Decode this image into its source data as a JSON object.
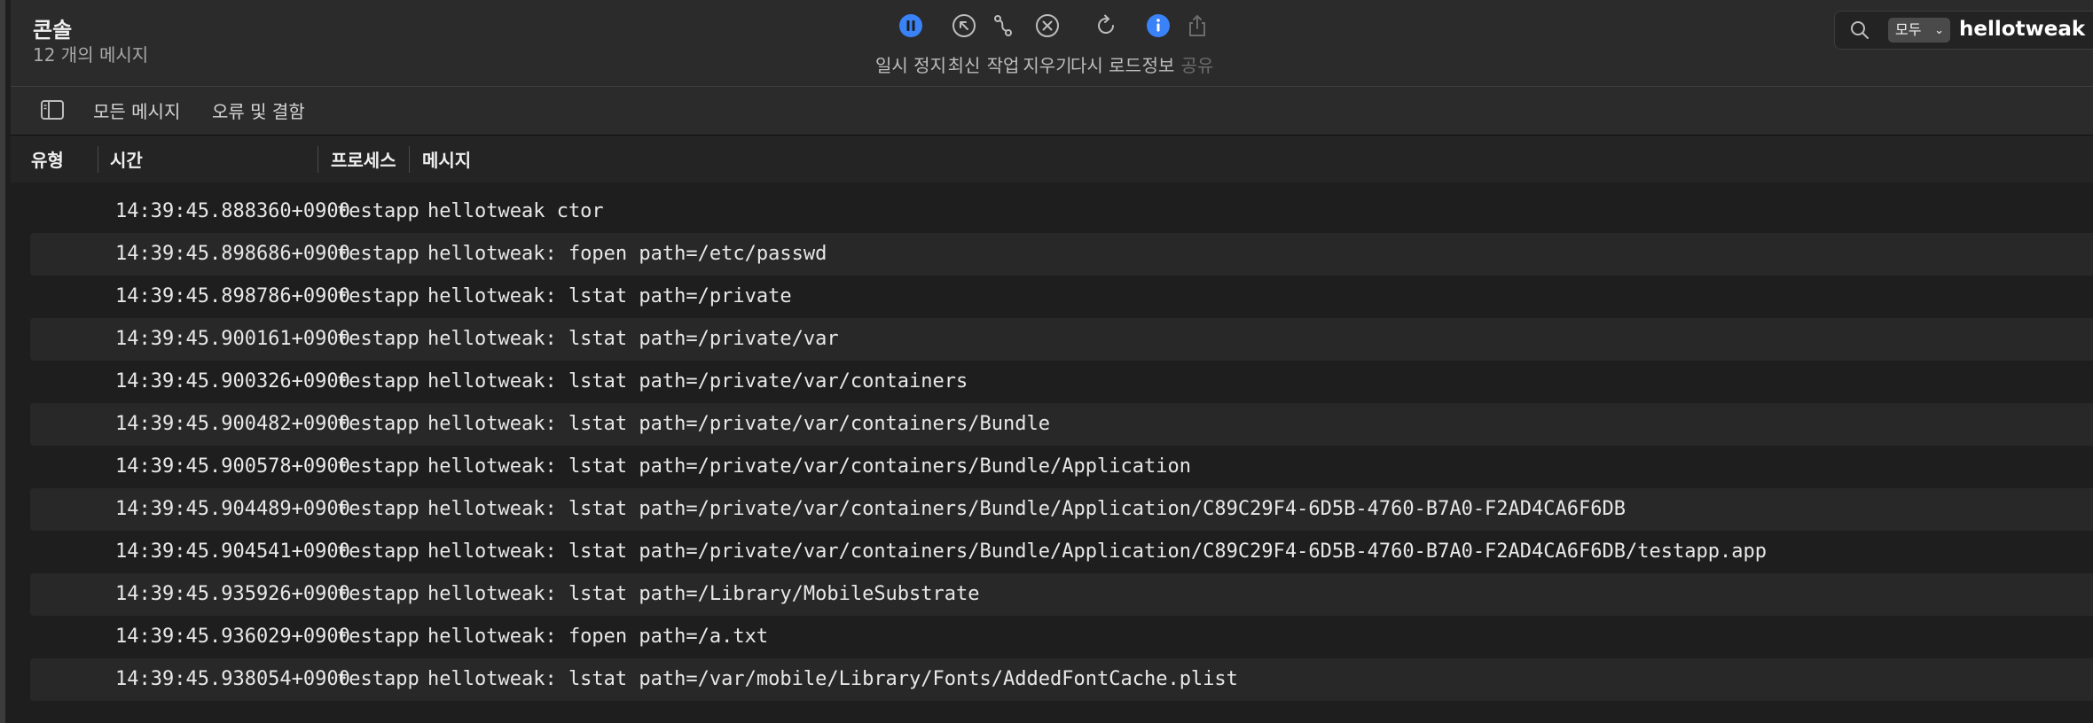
{
  "window": {
    "title": "콘솔",
    "subtitle": "12 개의 메시지"
  },
  "toolbar": {
    "buttons": [
      {
        "label": "일시 정지",
        "icon": "pause-circle-icon"
      },
      {
        "label": "최신",
        "icon": "arrow-up-left-circle-icon"
      },
      {
        "label": "작업",
        "icon": "activity-path-icon"
      },
      {
        "label": "지우기",
        "icon": "x-circle-icon"
      },
      {
        "label": "다시 로드",
        "icon": "reload-icon"
      },
      {
        "label": "정보",
        "icon": "info-circle-icon"
      },
      {
        "label": "공유",
        "icon": "share-icon",
        "disabled": true
      }
    ],
    "accent_color": "#3a82f7"
  },
  "search": {
    "scope": "모두",
    "value": "hellotweak"
  },
  "filters": {
    "all_messages": "모든 메시지",
    "errors_faults": "오류 및 결함"
  },
  "columns": {
    "type": "유형",
    "time": "시간",
    "process": "프로세스",
    "message": "메시지"
  },
  "rows": [
    {
      "time": "14:39:45.888360+0900",
      "process": "testapp",
      "message": "hellotweak ctor"
    },
    {
      "time": "14:39:45.898686+0900",
      "process": "testapp",
      "message": "hellotweak: fopen path=/etc/passwd"
    },
    {
      "time": "14:39:45.898786+0900",
      "process": "testapp",
      "message": "hellotweak: lstat path=/private"
    },
    {
      "time": "14:39:45.900161+0900",
      "process": "testapp",
      "message": "hellotweak: lstat path=/private/var"
    },
    {
      "time": "14:39:45.900326+0900",
      "process": "testapp",
      "message": "hellotweak: lstat path=/private/var/containers"
    },
    {
      "time": "14:39:45.900482+0900",
      "process": "testapp",
      "message": "hellotweak: lstat path=/private/var/containers/Bundle"
    },
    {
      "time": "14:39:45.900578+0900",
      "process": "testapp",
      "message": "hellotweak: lstat path=/private/var/containers/Bundle/Application"
    },
    {
      "time": "14:39:45.904489+0900",
      "process": "testapp",
      "message": "hellotweak: lstat path=/private/var/containers/Bundle/Application/C89C29F4-6D5B-4760-B7A0-F2AD4CA6F6DB"
    },
    {
      "time": "14:39:45.904541+0900",
      "process": "testapp",
      "message": "hellotweak: lstat path=/private/var/containers/Bundle/Application/C89C29F4-6D5B-4760-B7A0-F2AD4CA6F6DB/testapp.app"
    },
    {
      "time": "14:39:45.935926+0900",
      "process": "testapp",
      "message": "hellotweak: lstat path=/Library/MobileSubstrate"
    },
    {
      "time": "14:39:45.936029+0900",
      "process": "testapp",
      "message": "hellotweak: fopen path=/a.txt"
    },
    {
      "time": "14:39:45.938054+0900",
      "process": "testapp",
      "message": "hellotweak: lstat path=/var/mobile/Library/Fonts/AddedFontCache.plist"
    }
  ]
}
